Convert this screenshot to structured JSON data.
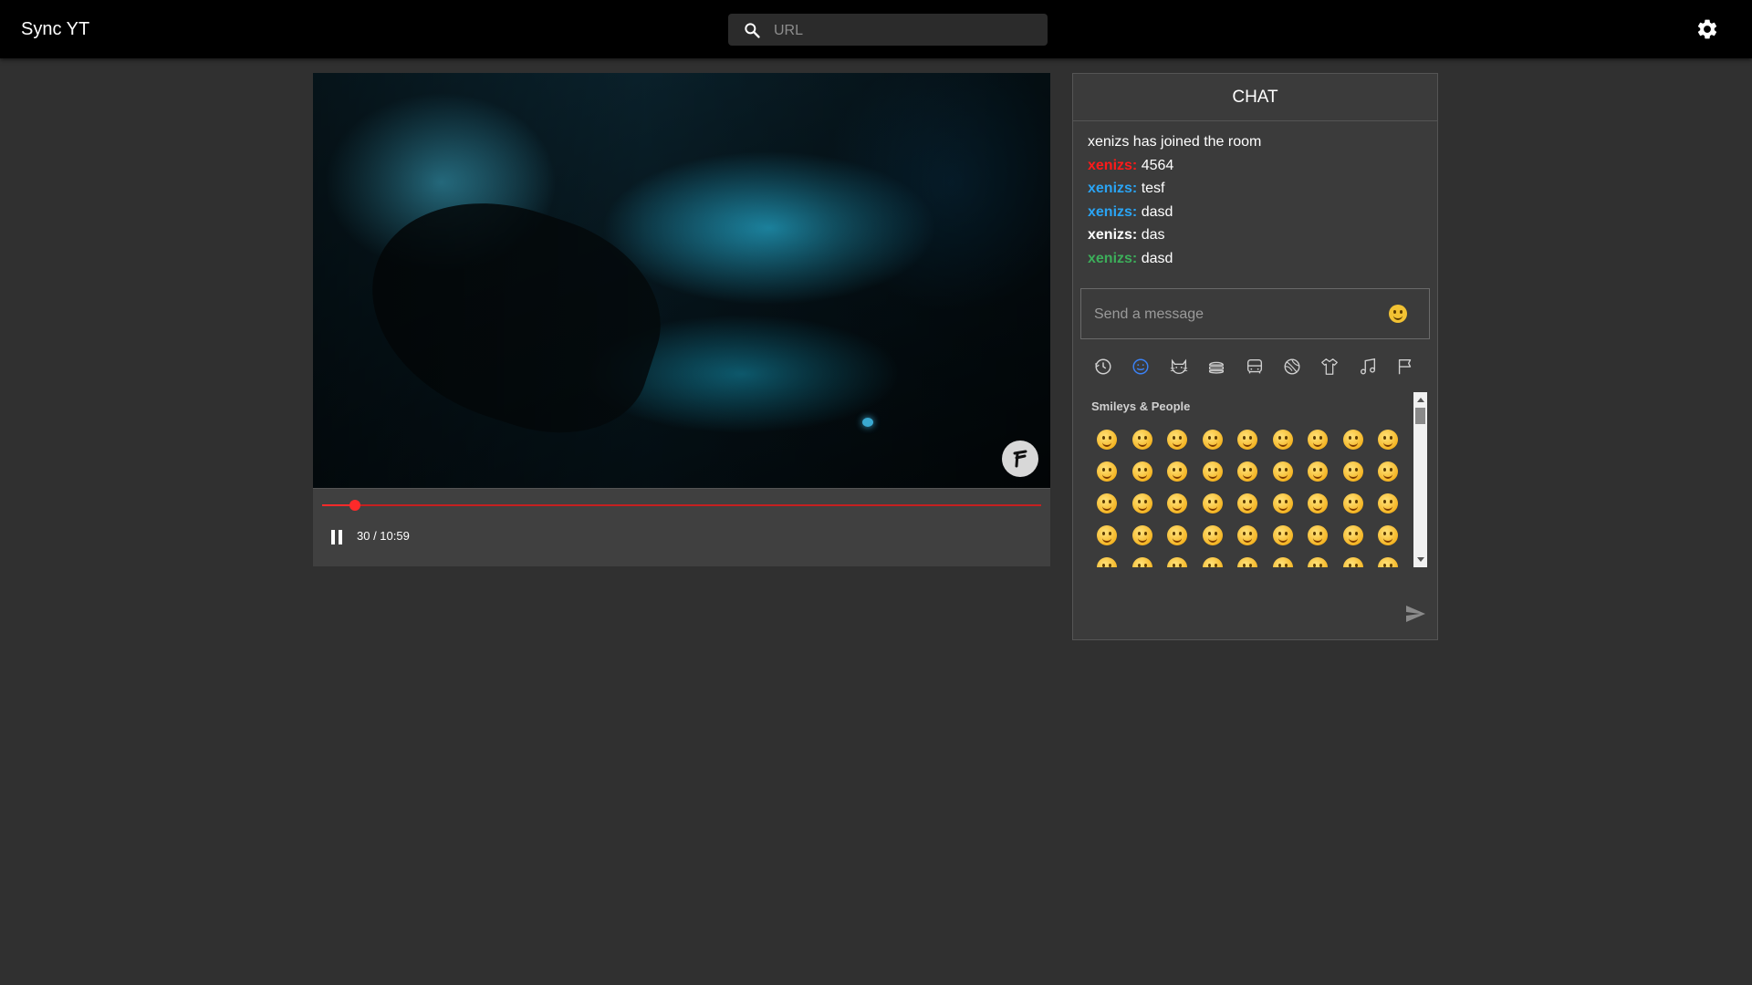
{
  "app": {
    "title": "Sync YT"
  },
  "search": {
    "placeholder": "URL",
    "value": ""
  },
  "player": {
    "progress_fraction": 0.046,
    "time_text": "30 / 10:59",
    "accent_color": "#ff2a2a"
  },
  "chat": {
    "title": "CHAT",
    "messages": [
      {
        "type": "system",
        "text": "xenizs has joined the room"
      },
      {
        "user": "xenizs:",
        "text": "4564",
        "user_color": "#ff1a1a"
      },
      {
        "user": "xenizs:",
        "text": "tesf",
        "user_color": "#2aa4f4"
      },
      {
        "user": "xenizs:",
        "text": "dasd",
        "user_color": "#2aa4f4"
      },
      {
        "user": "xenizs:",
        "text": "das",
        "user_color": "#ffffff"
      },
      {
        "user": "xenizs:",
        "text": "dasd",
        "user_color": "#3cae5a"
      }
    ],
    "composer": {
      "placeholder": "Send a message",
      "value": ""
    }
  },
  "emoji_picker": {
    "categories": [
      "recent-icon",
      "smileys-icon",
      "animals-icon",
      "food-icon",
      "travel-icon",
      "activity-icon",
      "objects-icon",
      "symbols-icon",
      "flags-icon"
    ],
    "active_category": "smileys-icon",
    "active_color": "#3b82f6",
    "section_title": "Smileys & People"
  }
}
